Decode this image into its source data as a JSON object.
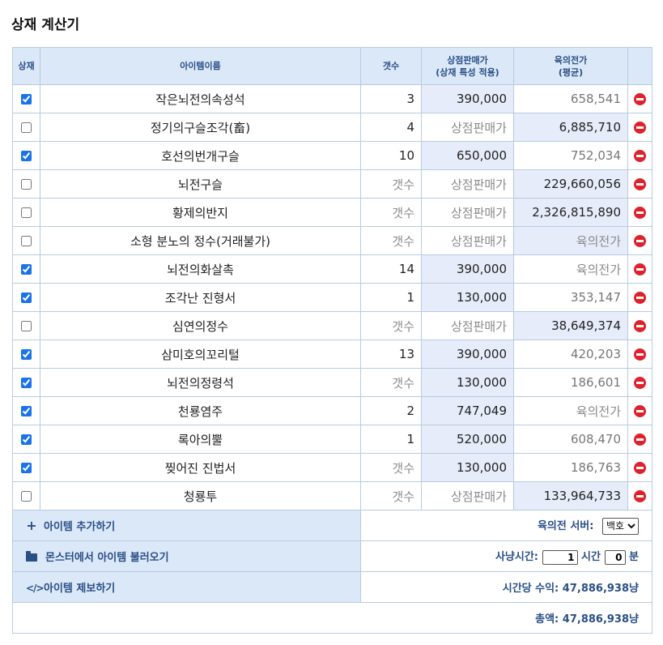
{
  "title": "상재 계산기",
  "headers": {
    "check": "상재",
    "name": "아이템이름",
    "qty": "갯수",
    "shop_line1": "상점판매가",
    "shop_line2": "(상재 특성 적용)",
    "market_line1": "육의전가",
    "market_line2": "(평균)"
  },
  "rows": [
    {
      "checked": true,
      "name": "작은뇌전의속성석",
      "qty": "3",
      "qty_placeholder": false,
      "shop": "390,000",
      "shop_placeholder": false,
      "market": "658,541",
      "market_placeholder": false
    },
    {
      "checked": false,
      "name": "정기의구슬조각(畜)",
      "qty": "4",
      "qty_placeholder": false,
      "shop": "상점판매가",
      "shop_placeholder": true,
      "market": "6,885,710",
      "market_placeholder": false
    },
    {
      "checked": true,
      "name": "호선의번개구슬",
      "qty": "10",
      "qty_placeholder": false,
      "shop": "650,000",
      "shop_placeholder": false,
      "market": "752,034",
      "market_placeholder": false
    },
    {
      "checked": false,
      "name": "뇌전구슬",
      "qty": "갯수",
      "qty_placeholder": true,
      "shop": "상점판매가",
      "shop_placeholder": true,
      "market": "229,660,056",
      "market_placeholder": false
    },
    {
      "checked": false,
      "name": "황제의반지",
      "qty": "갯수",
      "qty_placeholder": true,
      "shop": "상점판매가",
      "shop_placeholder": true,
      "market": "2,326,815,890",
      "market_placeholder": false
    },
    {
      "checked": false,
      "name": "소형 분노의 정수(거래불가)",
      "qty": "갯수",
      "qty_placeholder": true,
      "shop": "상점판매가",
      "shop_placeholder": true,
      "market": "육의전가",
      "market_placeholder": true
    },
    {
      "checked": true,
      "name": "뇌전의화살촉",
      "qty": "14",
      "qty_placeholder": false,
      "shop": "390,000",
      "shop_placeholder": false,
      "market": "육의전가",
      "market_placeholder": true
    },
    {
      "checked": true,
      "name": "조각난 진형서",
      "qty": "1",
      "qty_placeholder": false,
      "shop": "130,000",
      "shop_placeholder": false,
      "market": "353,147",
      "market_placeholder": false
    },
    {
      "checked": false,
      "name": "심연의정수",
      "qty": "갯수",
      "qty_placeholder": true,
      "shop": "상점판매가",
      "shop_placeholder": true,
      "market": "38,649,374",
      "market_placeholder": false
    },
    {
      "checked": true,
      "name": "삼미호의꼬리털",
      "qty": "13",
      "qty_placeholder": false,
      "shop": "390,000",
      "shop_placeholder": false,
      "market": "420,203",
      "market_placeholder": false
    },
    {
      "checked": true,
      "name": "뇌전의정령석",
      "qty": "갯수",
      "qty_placeholder": true,
      "shop": "130,000",
      "shop_placeholder": false,
      "market": "186,601",
      "market_placeholder": false
    },
    {
      "checked": true,
      "name": "천룡염주",
      "qty": "2",
      "qty_placeholder": false,
      "shop": "747,049",
      "shop_placeholder": false,
      "market": "육의전가",
      "market_placeholder": true
    },
    {
      "checked": true,
      "name": "록아의뿔",
      "qty": "1",
      "qty_placeholder": false,
      "shop": "520,000",
      "shop_placeholder": false,
      "market": "608,470",
      "market_placeholder": false
    },
    {
      "checked": true,
      "name": "찢어진 진법서",
      "qty": "갯수",
      "qty_placeholder": true,
      "shop": "130,000",
      "shop_placeholder": false,
      "market": "186,763",
      "market_placeholder": false
    },
    {
      "checked": false,
      "name": "청룡투",
      "qty": "갯수",
      "qty_placeholder": true,
      "shop": "상점판매가",
      "shop_placeholder": true,
      "market": "133,964,733",
      "market_placeholder": false
    }
  ],
  "footer": {
    "add_item": "아이템 추가하기",
    "load_monster": "몬스터에서 아이템 불러오기",
    "report_item": "아이템 제보하기",
    "server_label": "육의전 서버:",
    "server_value": "백호",
    "hunt_label": "사냥시간:",
    "hours_value": "1",
    "hours_unit": "시간",
    "minutes_value": "0",
    "minutes_unit": "분",
    "hourly_income": "시간당 수익: 47,886,938냥",
    "total": "총액: 47,886,938냥"
  },
  "icons": {
    "add": "plus-icon",
    "load": "folder-open-icon",
    "report": "code-icon",
    "delete": "minus-circle-icon"
  },
  "colors": {
    "header_bg": "#dbe8f8",
    "accent_text": "#2a4f86",
    "highlight_cell": "#e6ecfa",
    "delete": "#e0202a"
  }
}
